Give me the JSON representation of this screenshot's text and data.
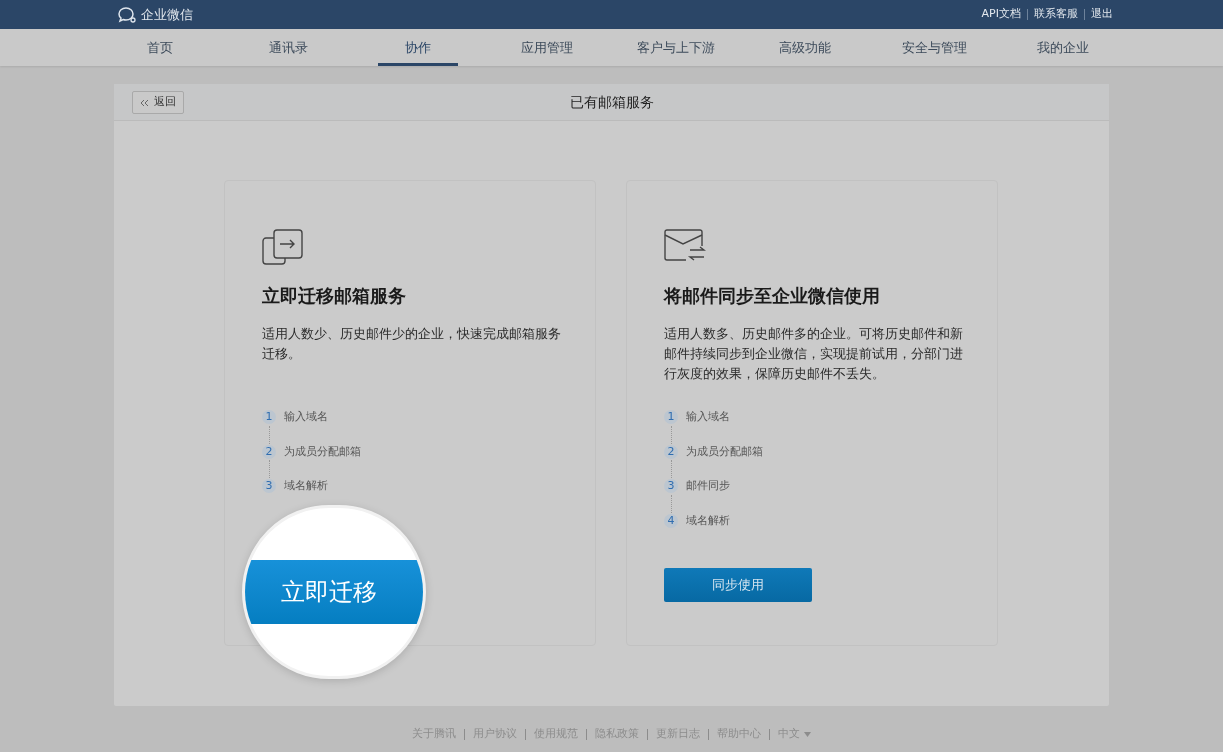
{
  "top_bar": {
    "logo": "企业微信",
    "links": [
      "API文档",
      "联系客服",
      "退出"
    ]
  },
  "nav": [
    {
      "label": "首页",
      "selected": false
    },
    {
      "label": "通讯录",
      "selected": false
    },
    {
      "label": "协作",
      "selected": true
    },
    {
      "label": "应用管理",
      "selected": false
    },
    {
      "label": "客户与上下游",
      "selected": false
    },
    {
      "label": "高级功能",
      "selected": false
    },
    {
      "label": "安全与管理",
      "selected": false
    },
    {
      "label": "我的企业",
      "selected": false
    }
  ],
  "panel": {
    "back_button": "返回",
    "title": "已有邮箱服务"
  },
  "options": [
    {
      "kind": "migrate",
      "title": "立即迁移邮箱服务",
      "description": "适用人数少、历史邮件少的企业，快速完成邮箱服务迁移。",
      "steps": [
        {
          "number": "1",
          "label": "输入域名"
        },
        {
          "number": "2",
          "label": "为成员分配邮箱"
        },
        {
          "number": "3",
          "label": "域名解析"
        }
      ],
      "button": "立即迁移",
      "magnified": true
    },
    {
      "kind": "sync",
      "title": "将邮件同步至企业微信使用",
      "description": "适用人数多、历史邮件多的企业。可将历史邮件和新邮件持续同步到企业微信，实现提前试用，分部门进行灰度的效果，保障历史邮件不丢失。",
      "steps": [
        {
          "number": "1",
          "label": "输入域名"
        },
        {
          "number": "2",
          "label": "为成员分配邮箱"
        },
        {
          "number": "3",
          "label": "邮件同步"
        },
        {
          "number": "4",
          "label": "域名解析"
        }
      ],
      "button": "同步使用",
      "magnified": false
    }
  ],
  "footer": {
    "links": [
      "关于腾讯",
      "用户协议",
      "使用规范",
      "隐私政策",
      "更新日志",
      "帮助中心"
    ],
    "language": "中文"
  }
}
